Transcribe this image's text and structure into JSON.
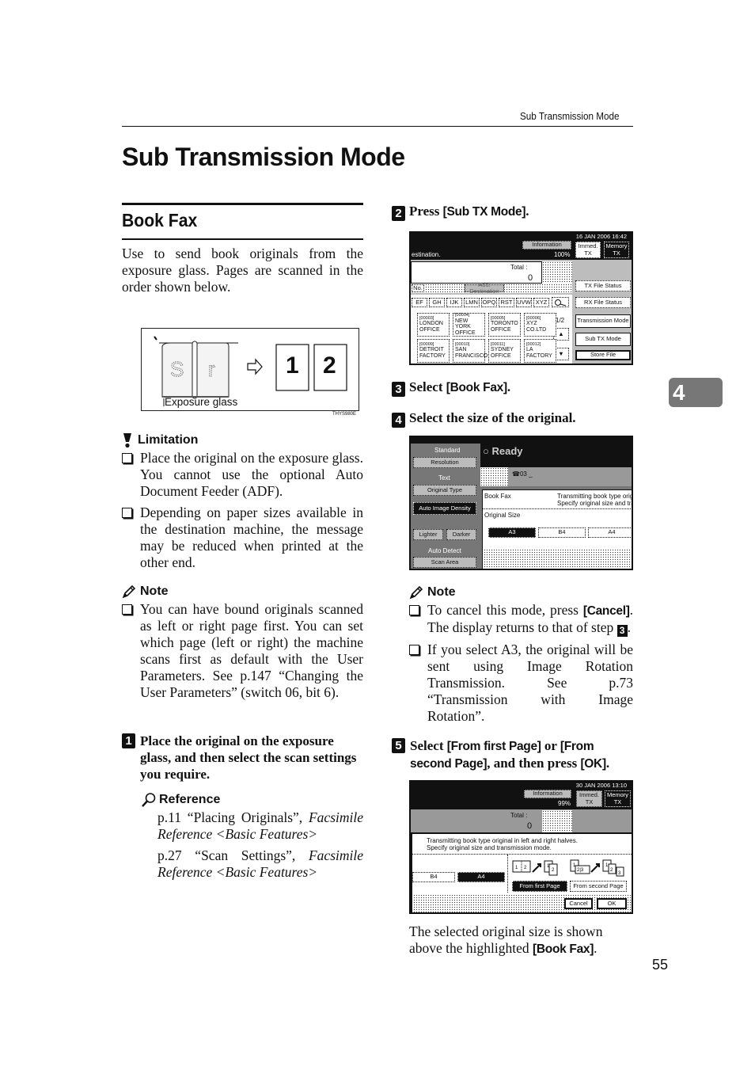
{
  "running_head": "Sub Transmission Mode",
  "page_title": "Sub Transmission Mode",
  "chapter_tab": "4",
  "page_number": "55",
  "section": {
    "title": "Book Fax",
    "intro": "Use to send book originals from the exposure glass. Pages are scanned in the order shown below."
  },
  "illustration": {
    "caption": "Exposure glass",
    "pages": [
      "1",
      "2"
    ],
    "code": "THYS980E",
    "icons": [
      "open-book-icon",
      "arrow-right-icon"
    ]
  },
  "limitation": {
    "heading": "Limitation",
    "items": [
      "Place the original on the exposure glass. You cannot use the optional Auto Document Feeder (ADF).",
      "Depending on paper sizes available in the destination machine, the message may be reduced when printed at the other end."
    ]
  },
  "note1": {
    "heading": "Note",
    "items": [
      "You can have bound originals scanned as left or right page first. You can set which page (left or right) the machine scans first as default with the User Parameters. See p.147 “Changing the User Parameters” (switch 06, bit 6)."
    ]
  },
  "steps": [
    {
      "num": "1",
      "text": "Place the original on the exposure glass, and then select the scan settings you require."
    },
    {
      "num": "2",
      "pre": "Press ",
      "key": "[Sub TX Mode]",
      "post": "."
    },
    {
      "num": "3",
      "pre": "Select ",
      "key": "[Book Fax]",
      "post": "."
    },
    {
      "num": "4",
      "text": "Select the size of the original."
    },
    {
      "num": "5",
      "pre": "Select ",
      "key": "[From first Page]",
      "mid": " or ",
      "key2": "[From second Page]",
      "mid2": ", and then press ",
      "key3": "[OK]",
      "post": "."
    }
  ],
  "reference": {
    "heading": "Reference",
    "items": [
      {
        "text": "p.11 “Placing Originals”, ",
        "italic": "Facsimile Reference <Basic Features>"
      },
      {
        "text": "p.27 “Scan Settings”, ",
        "italic": "Facsimile Reference <Basic Features>"
      }
    ]
  },
  "note2": {
    "heading": "Note",
    "item1_pre": "To cancel this mode, press ",
    "item1_key": "[Cancel]",
    "item1_mid": ". The display returns to that of step ",
    "item1_step": "3",
    "item1_post": ".",
    "item2": "If you select A3, the original will be sent using Image Rotation Transmission. See p.73 “Transmission with Image Rotation”."
  },
  "closing": {
    "pre": "The selected original size is shown above the highlighted ",
    "key": "[Book Fax]",
    "post": "."
  },
  "panel1": {
    "datetime": "16 JAN   2006 16:42",
    "destination": "estination.",
    "information": "Information",
    "memory": "100%",
    "immed_tx": "Immed. TX",
    "memory_tx": "Memory TX",
    "total_label": "Total :",
    "total_value": "0",
    "no_label": "No.",
    "add_dest": "Add. Destination",
    "tx_file_status": "TX File Status",
    "rx_file_status": "RX File Status",
    "transmission_mode": "Transmission Mode",
    "sub_tx_mode": "Sub TX Mode",
    "store_file": "Store File",
    "index_tabs": [
      "EF",
      "GH",
      "IJK",
      "LMN",
      "OPQ",
      "RST",
      "UVW",
      "XYZ"
    ],
    "page_indicator": "1/2",
    "destinations": [
      {
        "id": "[00003]",
        "name": "LONDON OFFICE"
      },
      {
        "id": "[00004]",
        "name": "NEW YORK OFFICE"
      },
      {
        "id": "[00005]",
        "name": "TORONTO OFFICE"
      },
      {
        "id": "[00006]",
        "name": "XYZ CO.LTD"
      },
      {
        "id": "[00009]",
        "name": "DETROIT FACTORY"
      },
      {
        "id": "[00010]",
        "name": "SAN FRANCISCO"
      },
      {
        "id": "[00011]",
        "name": "SYDNEY OFFICE"
      },
      {
        "id": "[00012]",
        "name": "LA FACTORY"
      }
    ]
  },
  "panel2": {
    "resolution_value": "Standard",
    "resolution": "Resolution",
    "original_type_value": "Text",
    "original_type": "Original Type",
    "auto_density": "Auto Image Density",
    "lighter": "Lighter",
    "darker": "Darker",
    "scan_area_value": "Auto Detect",
    "scan_area": "Scan Area",
    "status": "Ready",
    "dest_count": "03",
    "dialog_title": "Book Fax",
    "dialog_desc1": "Transmitting book type original",
    "dialog_desc2": "Specify original size and transm",
    "original_size_label": "Original Size",
    "sizes": [
      "A3",
      "B4",
      "A4"
    ],
    "selected_size": "A3"
  },
  "panel3": {
    "datetime": "30 JAN   2006 13:10",
    "information": "Information",
    "memory": "99%",
    "immed_tx": "Immed. TX",
    "memory_tx": "Memory TX",
    "total_label": "Total :",
    "total_value": "0",
    "desc1": "Transmitting book type original in left and right halves.",
    "desc2": "Specify original size and transmission mode.",
    "sizes": [
      "B4",
      "A4"
    ],
    "selected_size": "A4",
    "from_first": "From first Page",
    "from_second": "From second Page",
    "cancel": "Cancel",
    "ok": "OK"
  }
}
